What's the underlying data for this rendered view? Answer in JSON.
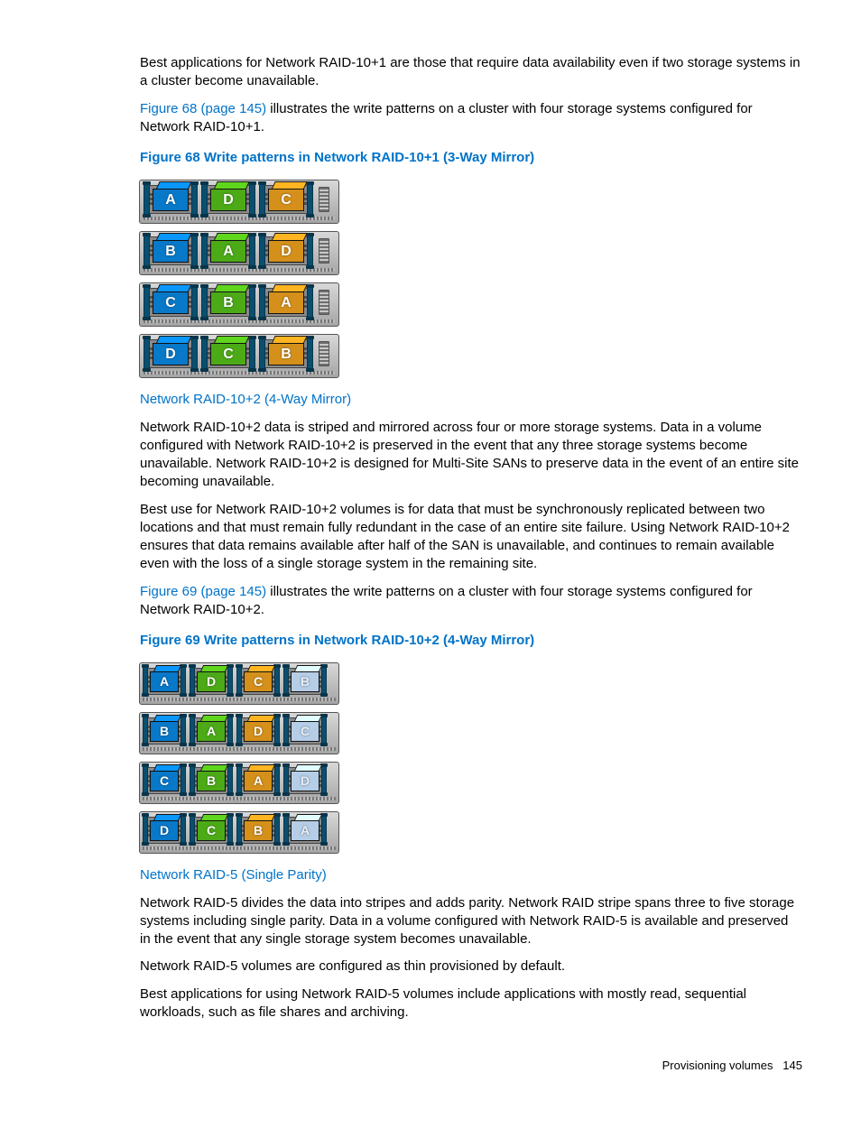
{
  "intro": {
    "p1": "Best applications for Network RAID-10+1 are those that require data availability even if two storage systems in a cluster become unavailable.",
    "link68": "Figure 68 (page 145)",
    "p2_rest": " illustrates the write patterns on a cluster with four storage systems configured for Network RAID-10+1."
  },
  "fig68_caption": "Figure 68 Write patterns in Network RAID-10+1 (3-Way Mirror)",
  "fig68": {
    "rows": [
      [
        {
          "t": "A",
          "c": "blue"
        },
        {
          "t": "D",
          "c": "green"
        },
        {
          "t": "C",
          "c": "orange"
        }
      ],
      [
        {
          "t": "B",
          "c": "blue"
        },
        {
          "t": "A",
          "c": "green"
        },
        {
          "t": "D",
          "c": "orange"
        }
      ],
      [
        {
          "t": "C",
          "c": "blue"
        },
        {
          "t": "B",
          "c": "green"
        },
        {
          "t": "A",
          "c": "orange"
        }
      ],
      [
        {
          "t": "D",
          "c": "blue"
        },
        {
          "t": "C",
          "c": "green"
        },
        {
          "t": "B",
          "c": "orange"
        }
      ]
    ]
  },
  "sec102": {
    "heading": "Network RAID-10+2 (4-Way Mirror)",
    "p1": "Network RAID-10+2 data is striped and mirrored across four or more storage systems. Data in a volume configured with Network RAID-10+2 is preserved in the event that any three storage systems become unavailable. Network RAID-10+2 is designed for Multi-Site SANs to preserve data in the event of an entire site becoming unavailable.",
    "p2": "Best use for Network RAID-10+2 volumes is for data that must be synchronously replicated between two locations and that must remain fully redundant in the case of an entire site failure. Using Network RAID-10+2 ensures that data remains available after half of the SAN is unavailable, and continues to remain available even with the loss of a single storage system in the remaining site.",
    "link69": "Figure 69 (page 145)",
    "p3_rest": " illustrates the write patterns on a cluster with four storage systems configured for Network RAID-10+2."
  },
  "fig69_caption": "Figure 69 Write patterns in Network RAID-10+2 (4-Way Mirror)",
  "fig69": {
    "rows": [
      [
        {
          "t": "A",
          "c": "blue"
        },
        {
          "t": "D",
          "c": "green"
        },
        {
          "t": "C",
          "c": "orange"
        },
        {
          "t": "B",
          "c": "light"
        }
      ],
      [
        {
          "t": "B",
          "c": "blue"
        },
        {
          "t": "A",
          "c": "green"
        },
        {
          "t": "D",
          "c": "orange"
        },
        {
          "t": "C",
          "c": "light"
        }
      ],
      [
        {
          "t": "C",
          "c": "blue"
        },
        {
          "t": "B",
          "c": "green"
        },
        {
          "t": "A",
          "c": "orange"
        },
        {
          "t": "D",
          "c": "light"
        }
      ],
      [
        {
          "t": "D",
          "c": "blue"
        },
        {
          "t": "C",
          "c": "green"
        },
        {
          "t": "B",
          "c": "orange"
        },
        {
          "t": "A",
          "c": "light"
        }
      ]
    ]
  },
  "sec5": {
    "heading": "Network RAID-5 (Single Parity)",
    "p1": "Network RAID-5 divides the data into stripes and adds parity. Network RAID stripe spans three to five storage systems including single parity. Data in a volume configured with Network RAID-5 is available and preserved in the event that any single storage system becomes unavailable.",
    "p2": "Network RAID-5 volumes are configured as thin provisioned by default.",
    "p3": "Best applications for using Network RAID-5 volumes include applications with mostly read, sequential workloads, such as file shares and archiving."
  },
  "footer": {
    "section": "Provisioning volumes",
    "page": "145"
  }
}
